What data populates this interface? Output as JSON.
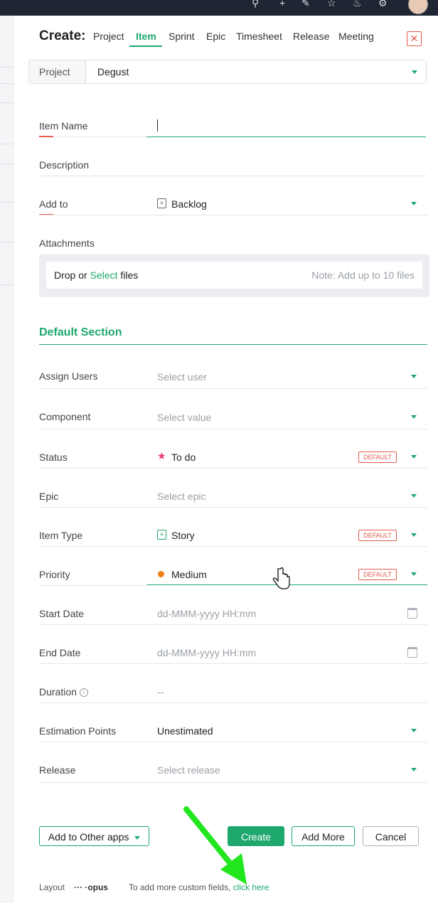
{
  "create": {
    "title": "Create:",
    "tabs": [
      "Project",
      "Item",
      "Sprint",
      "Epic",
      "Timesheet",
      "Release",
      "Meeting"
    ],
    "active_tab": "Item",
    "close_icon": "close-icon"
  },
  "project": {
    "label": "Project",
    "value": "Degust"
  },
  "fields": {
    "item_name": {
      "label": "Item Name",
      "value": ""
    },
    "description": {
      "label": "Description"
    },
    "add_to": {
      "label": "Add to",
      "value": "Backlog",
      "icon": "backlog-icon"
    },
    "attachments": {
      "label": "Attachments",
      "drop": "Drop or",
      "select": "Select",
      "files": "files",
      "note": "Note: Add up to 10 files"
    }
  },
  "section": {
    "title": "Default Section",
    "rows": {
      "assign_users": {
        "label": "Assign Users",
        "placeholder": "Select user"
      },
      "component": {
        "label": "Component",
        "placeholder": "Select value"
      },
      "status": {
        "label": "Status",
        "value": "To do",
        "badge": "DEFAULT",
        "icon": "star-icon",
        "icon_color": "#e8396b"
      },
      "epic": {
        "label": "Epic",
        "placeholder": "Select epic"
      },
      "item_type": {
        "label": "Item Type",
        "value": "Story",
        "badge": "DEFAULT",
        "icon": "story-icon"
      },
      "priority": {
        "label": "Priority",
        "value": "Medium",
        "badge": "DEFAULT",
        "icon": "dot-icon",
        "icon_color": "#f07f18"
      },
      "start_date": {
        "label": "Start Date",
        "placeholder": "dd-MMM-yyyy HH:mm"
      },
      "end_date": {
        "label": "End Date",
        "placeholder": "dd-MMM-yyyy HH:mm"
      },
      "duration": {
        "label": "Duration",
        "value": "--"
      },
      "estimation": {
        "label": "Estimation Points",
        "value": "Unestimated"
      },
      "release": {
        "label": "Release",
        "placeholder": "Select release"
      }
    }
  },
  "buttons": {
    "add_other": "Add to Other apps",
    "create": "Create",
    "add_more": "Add More",
    "cancel": "Cancel"
  },
  "footer": {
    "layout": "Layout",
    "layout_name": "··· ·opus",
    "hint": "To add more custom fields,",
    "link": "click here"
  },
  "colors": {
    "accent": "#1ea86c",
    "required": "#e45b4f",
    "annotation_arrow": "#22e61e"
  }
}
